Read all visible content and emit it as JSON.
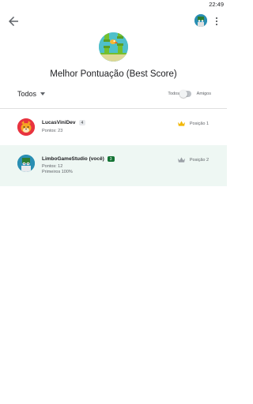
{
  "status": {
    "time": "22:49"
  },
  "page": {
    "title": "Melhor Pontuação (Best Score)"
  },
  "filter": {
    "scope_selected": "Todos",
    "toggle_left": "Todos",
    "toggle_right": "Amigos",
    "toggle_on": false
  },
  "leaderboard": [
    {
      "name": "LucasViniDev",
      "level": "4",
      "points": "Pontos: 23",
      "extra": "",
      "position": "Posição 1",
      "crown_color": "#f2b705"
    },
    {
      "name": "LimboGameStudio (você)",
      "level": "3",
      "points": "Pontos: 12",
      "extra": "Primeiros 100%",
      "position": "Posição 2",
      "crown_color": "#9aa0a6"
    }
  ],
  "colors": {
    "highlight_row": "#eef7f3",
    "level_badge_self": "#137333",
    "divider": "#e0e0e0"
  },
  "icons": {
    "back": "arrow-left-icon",
    "profile": "avatar-icon",
    "menu": "more-vert-icon",
    "game": "flappy-bird-game-icon",
    "dropdown": "caret-down-icon",
    "rank": "crown-icon"
  }
}
